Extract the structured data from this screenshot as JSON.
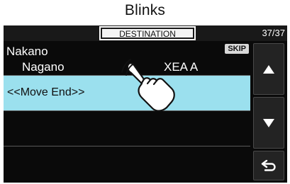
{
  "callout": {
    "label": "Blinks"
  },
  "header": {
    "title": "DESTINATION",
    "counter": "37/37"
  },
  "list": {
    "items": [
      {
        "name": "Nakano",
        "sub_left": "Nagano",
        "sub_right": "XEA A",
        "badge": "SKIP",
        "selected": false
      },
      {
        "name": "<<Move End>>",
        "selected": true
      }
    ]
  },
  "sidebar": {
    "buttons": [
      {
        "icon": "up-arrow-icon"
      },
      {
        "icon": "down-arrow-icon"
      },
      {
        "icon": "back-arrow-icon"
      }
    ]
  },
  "overlay": {
    "icon": "pointing-hand-icon"
  },
  "colors": {
    "selected_row": "#9be0ee",
    "screen_bg": "#0a0a0a"
  }
}
